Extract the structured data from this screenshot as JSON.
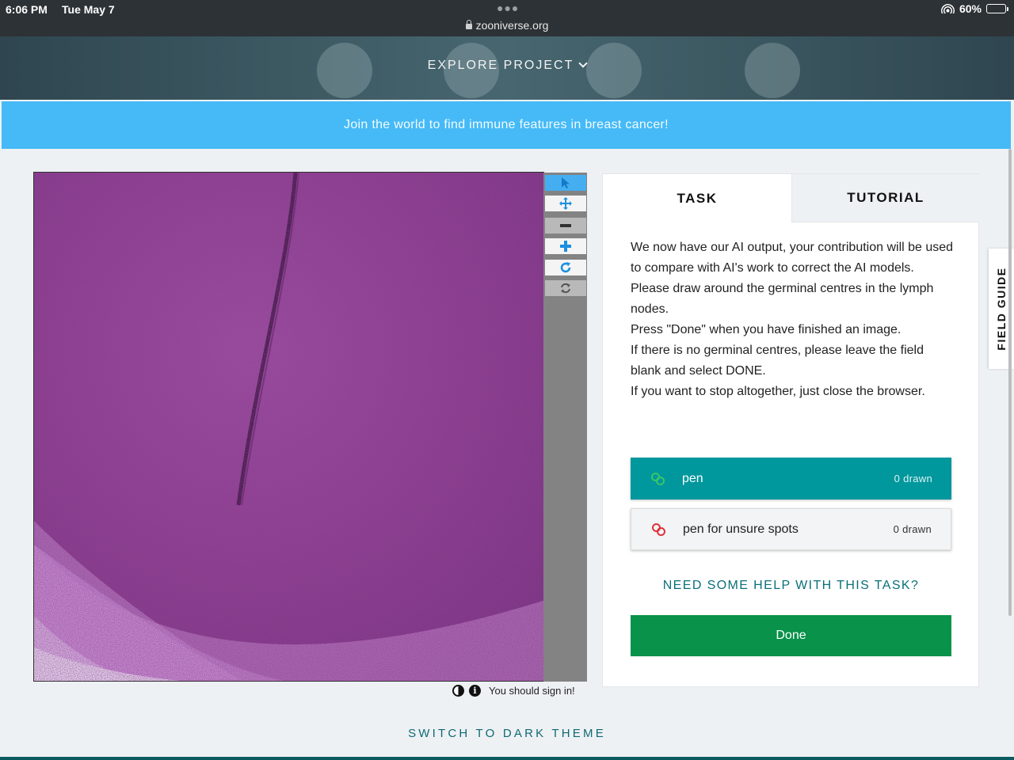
{
  "status_bar": {
    "time": "6:06 PM",
    "date": "Tue May 7",
    "url": "zooniverse.org",
    "battery": "60%",
    "battery_level": 0.6
  },
  "header": {
    "explore_label": "EXPLORE PROJECT"
  },
  "banner": {
    "text": "Join the world to find immune features in breast cancer!"
  },
  "viewer": {
    "image_icon": "histology-image",
    "tools": [
      {
        "name": "annotate-tool",
        "icon": "cursor-arrow-icon",
        "active": true
      },
      {
        "name": "move-tool",
        "icon": "move-arrows-icon",
        "active": false
      },
      {
        "name": "zoom-out-tool",
        "icon": "minus-icon",
        "active": false
      },
      {
        "name": "zoom-in-tool",
        "icon": "plus-icon",
        "active": false
      },
      {
        "name": "rotate-tool",
        "icon": "rotate-icon",
        "active": false
      },
      {
        "name": "reset-tool",
        "icon": "refresh-icon",
        "active": false
      }
    ],
    "sign_in_note": "You should sign in!"
  },
  "panel": {
    "tabs": [
      "TASK",
      "TUTORIAL"
    ],
    "instructions": [
      "We now have our AI output, your contribution will be used to compare with AI's work to correct the AI models.",
      "Please draw around the germinal centres in the lymph nodes.",
      "Press \"Done\" when you have finished an image.",
      "If there is no germinal centres, please leave the field blank and select DONE.",
      "If you want to stop altogether, just close the browser."
    ],
    "tools": [
      {
        "label": "pen",
        "count": "0 drawn",
        "color": "#38c66a"
      },
      {
        "label": "pen for unsure spots",
        "count": "0 drawn",
        "color": "#e0323c"
      }
    ],
    "help_label": "NEED SOME HELP WITH THIS TASK?",
    "done_label": "Done"
  },
  "field_guide_label": "FIELD GUIDE",
  "theme_toggle_label": "SWITCH TO DARK THEME",
  "colors": {
    "banner": "#45baf7",
    "pen_tool": "#00979d",
    "done": "#08924a",
    "link": "#0a6f7a"
  }
}
